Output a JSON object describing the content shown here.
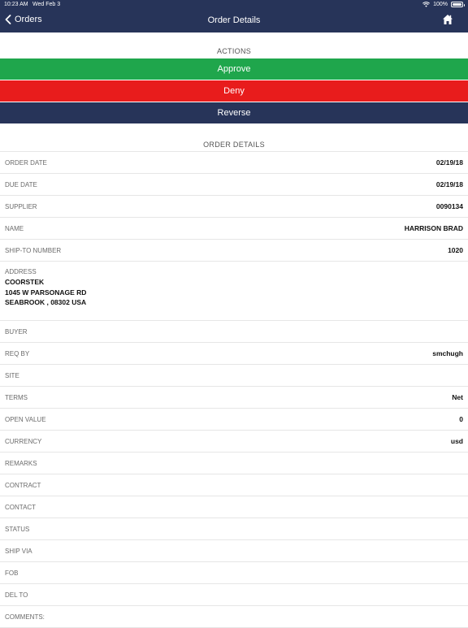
{
  "statusbar": {
    "time": "10:23 AM",
    "date": "Wed Feb 3",
    "battery": "100%"
  },
  "nav": {
    "back_label": "Orders",
    "title": "Order Details"
  },
  "actions": {
    "header": "ACTIONS",
    "approve": "Approve",
    "deny": "Deny",
    "reverse": "Reverse",
    "colors": {
      "approve": "#1fa64c",
      "deny": "#e81c1c",
      "reverse": "#273459"
    }
  },
  "details": {
    "header": "ORDER DETAILS",
    "rows_before_address": [
      {
        "label": "ORDER DATE",
        "value": "02/19/18"
      },
      {
        "label": "DUE DATE",
        "value": "02/19/18"
      },
      {
        "label": "SUPPLIER",
        "value": "0090134"
      },
      {
        "label": "NAME",
        "value": "HARRISON BRAD"
      },
      {
        "label": "SHIP-TO NUMBER",
        "value": "1020"
      }
    ],
    "address": {
      "label": "ADDRESS",
      "lines": [
        "COORSTEK",
        "1045 W PARSONAGE RD",
        "SEABROOK , 08302 USA"
      ]
    },
    "rows_after_address": [
      {
        "label": "BUYER",
        "value": ""
      },
      {
        "label": "REQ BY",
        "value": "smchugh"
      },
      {
        "label": "SITE",
        "value": ""
      },
      {
        "label": "TERMS",
        "value": "Net"
      },
      {
        "label": "OPEN VALUE",
        "value": "0"
      },
      {
        "label": "CURRENCY",
        "value": "usd"
      },
      {
        "label": "REMARKS",
        "value": ""
      },
      {
        "label": "CONTRACT",
        "value": ""
      },
      {
        "label": "CONTACT",
        "value": ""
      },
      {
        "label": "STATUS",
        "value": ""
      },
      {
        "label": "SHIP VIA",
        "value": ""
      },
      {
        "label": "FOB",
        "value": ""
      },
      {
        "label": "DEL TO",
        "value": ""
      },
      {
        "label": "COMMENTS:",
        "value": ""
      }
    ]
  },
  "icons": {
    "back": "chevron-left-icon",
    "home": "home-icon",
    "wifi": "wifi-icon",
    "battery": "battery-icon"
  },
  "theme": {
    "nav_bg": "#273459",
    "divider": "#e6e6e6"
  }
}
